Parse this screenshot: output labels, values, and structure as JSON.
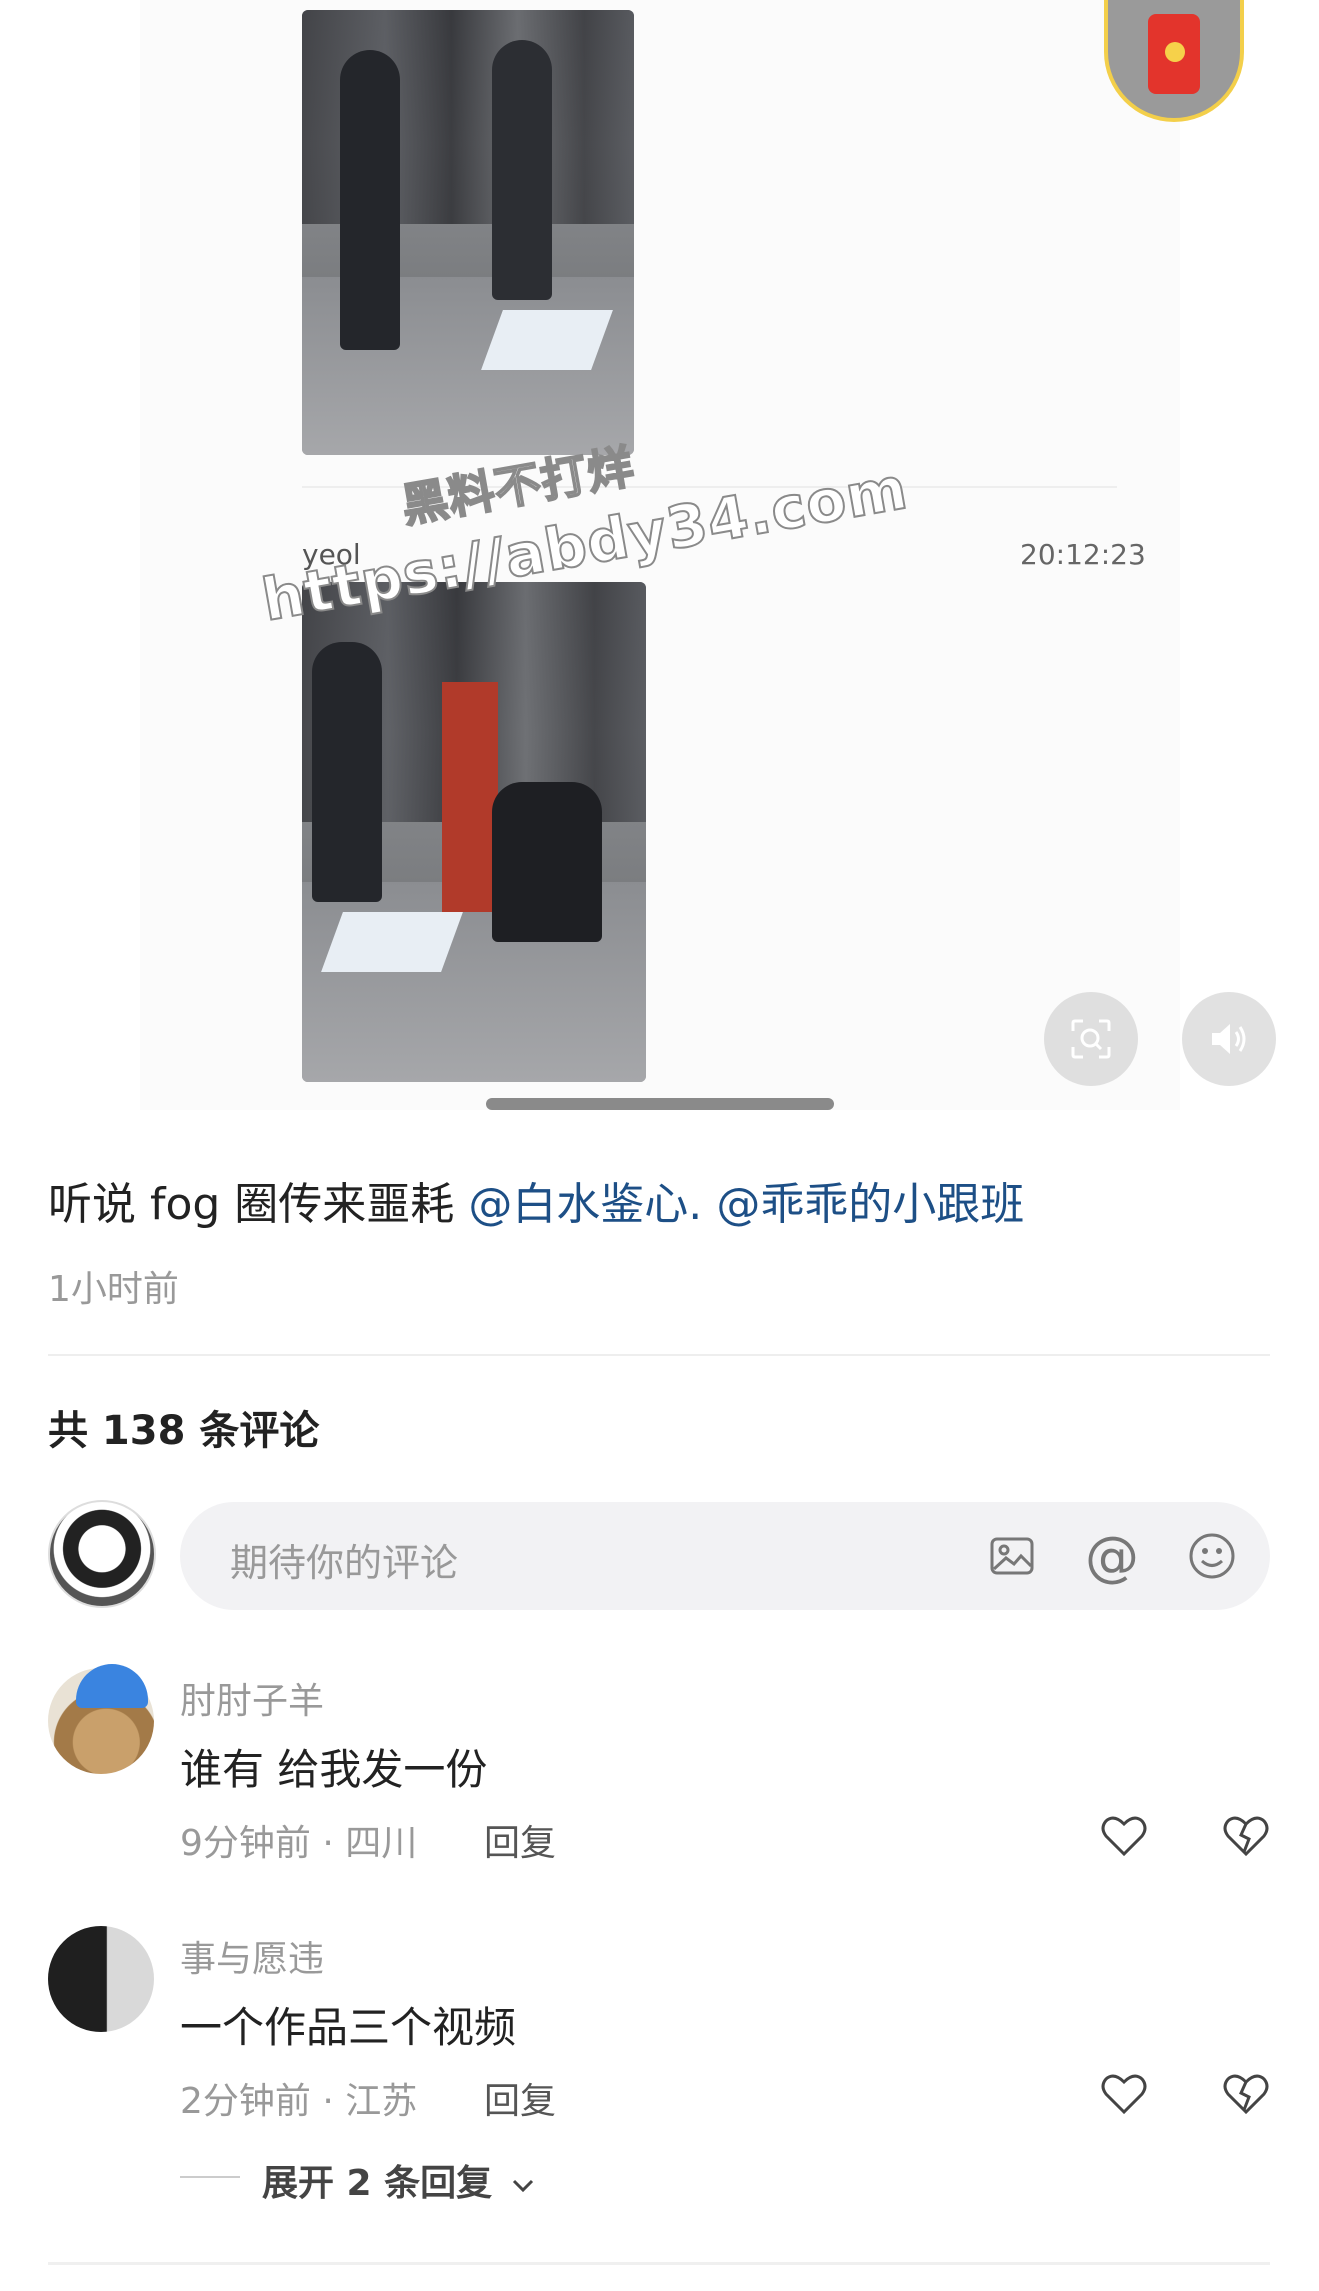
{
  "chat": {
    "sender": "yeol",
    "time": "20:12:23",
    "watermark_line1": "黑料不打烊",
    "watermark_line2": "https://abdy34.com"
  },
  "post": {
    "caption_text": "听说 fog 圈传来噩耗 ",
    "mention_1": "@白水鉴心.",
    "mention_2": "@乖乖的小跟班",
    "time": "1小时前"
  },
  "comments_header": {
    "count_label": "共 138 条评论"
  },
  "input": {
    "placeholder": "期待你的评论",
    "at_symbol": "@"
  },
  "comments": [
    {
      "user": "肘肘子羊",
      "text": "谁有 给我发一份",
      "meta": "9分钟前 · 四川",
      "reply": "回复"
    },
    {
      "user": "事与愿违",
      "text": "一个作品三个视频",
      "meta": "2分钟前 · 江苏",
      "reply": "回复"
    }
  ],
  "expand_replies": "展开 2 条回复",
  "icons": {
    "red_packet": "red-envelope-icon",
    "scan": "scan-search-icon",
    "sound": "speaker-icon",
    "image": "image-icon",
    "emoji": "emoji-icon",
    "like": "heart-icon",
    "dislike": "broken-heart-icon",
    "chevron": "chevron-down-icon"
  },
  "colors": {
    "mention": "#1d4f86",
    "muted": "#999999",
    "red_packet": "#e3342c"
  }
}
